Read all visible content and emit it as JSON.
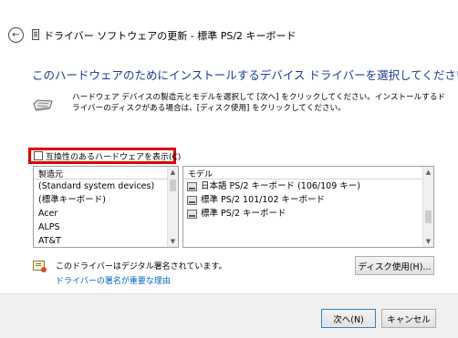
{
  "window": {
    "title": "ドライバー ソフトウェアの更新 - 標準 PS/2 キーボード"
  },
  "main": {
    "headline": "このハードウェアのためにインストールするデバイス ドライバーを選択してください。",
    "description": "ハードウェア デバイスの製造元とモデルを選択して [次へ] をクリックしてください。インストールするドライバーのディスクがある場合は、[ディスク使用] をクリックしてください。",
    "compatible_checkbox_label": "互換性のあるハードウェアを表示(C)",
    "compatible_checked": false
  },
  "manufacturer_list": {
    "header": "製造元",
    "items": [
      "(Standard system devices)",
      "(標準キーボード)",
      "Acer",
      "ALPS",
      "AT&T"
    ]
  },
  "model_list": {
    "header": "モデル",
    "items": [
      "日本語 PS/2 キーボード (106/109 キー)",
      "標準 PS/2 101/102 キーボード",
      "標準 PS/2 キーボード"
    ]
  },
  "signature": {
    "status_text": "このドライバーはデジタル署名されています。",
    "link_text": "ドライバーの署名が重要な理由"
  },
  "buttons": {
    "have_disk": "ディスク使用(H)...",
    "next": "次へ(N)",
    "cancel": "キャンセル"
  },
  "icons": {
    "back": "back-arrow-icon",
    "title": "keyboard-device-icon",
    "device": "keyboard-icon",
    "model_item": "keyboard-driver-icon",
    "signature": "certificate-icon"
  },
  "colors": {
    "headline": "#1c3a99",
    "link": "#0066cc",
    "highlight_border": "#e00000",
    "footer_bg": "#f0f0f0"
  }
}
